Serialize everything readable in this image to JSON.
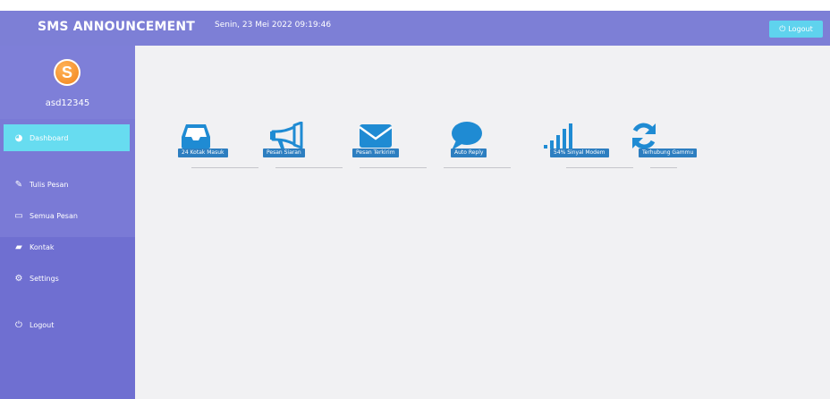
{
  "header": {
    "brand": "SMS ANNOUNCEMENT",
    "datetime": "Senin, 23 Mei 2022 09:19:46",
    "logout_label": "Logout"
  },
  "user": {
    "avatar_letter": "S",
    "username": "asd12345"
  },
  "sidebar": {
    "items": [
      {
        "label": "Dashboard",
        "icon": "dashboard-icon",
        "active": true
      },
      {
        "label": "Tulis Pesan",
        "icon": "edit-icon",
        "active": false
      },
      {
        "label": "Semua Pesan",
        "icon": "folder-icon",
        "active": false
      },
      {
        "label": "Kontak",
        "icon": "book-icon",
        "active": false
      },
      {
        "label": "Settings",
        "icon": "gears-icon",
        "active": false
      },
      {
        "label": "Logout",
        "icon": "power-icon",
        "active": false
      }
    ]
  },
  "tiles": [
    {
      "label": "24 Kotak Masuk",
      "icon": "inbox-icon"
    },
    {
      "label": "Pesan Siaran",
      "icon": "megaphone-icon"
    },
    {
      "label": "Pesan Terkirim",
      "icon": "envelope-icon"
    },
    {
      "label": "Auto Reply",
      "icon": "speech-bubble-icon"
    },
    {
      "label": "54% Sinyal Modem",
      "icon": "signal-bars-icon"
    },
    {
      "label": "Terhubung Gammu",
      "icon": "refresh-icon"
    }
  ],
  "colors": {
    "header_bg": "#7d7fd6",
    "sidebar_bg": "#7a7ad6",
    "active_item": "#67dcf0",
    "logout_button": "#5fd3ee",
    "tile_icon": "#1f8bd3",
    "badge_bg": "#2d7ec0"
  }
}
